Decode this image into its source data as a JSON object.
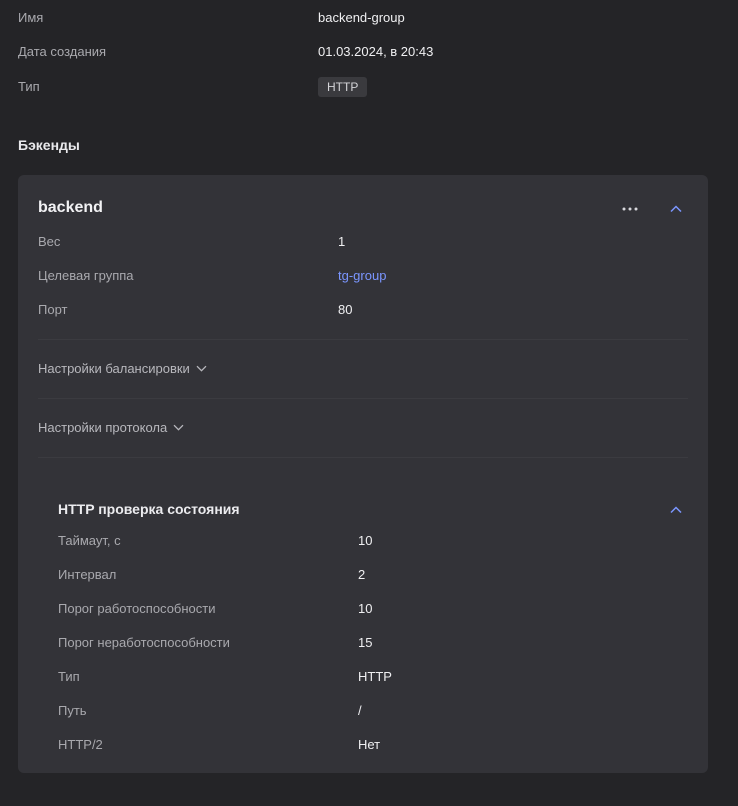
{
  "summary": {
    "name_label": "Имя",
    "name_value": "backend-group",
    "created_label": "Дата создания",
    "created_value": "01.03.2024, в 20:43",
    "type_label": "Тип",
    "type_value": "HTTP"
  },
  "backends_section": {
    "title": "Бэкенды"
  },
  "backend": {
    "title": "backend",
    "weight_label": "Вес",
    "weight_value": "1",
    "target_group_label": "Целевая группа",
    "target_group_value": "tg-group",
    "port_label": "Порт",
    "port_value": "80",
    "balancing_settings_label": "Настройки балансировки",
    "protocol_settings_label": "Настройки протокола"
  },
  "healthcheck": {
    "title": "HTTP проверка состояния",
    "rows": [
      {
        "label": "Таймаут, с",
        "value": "10"
      },
      {
        "label": "Интервал",
        "value": "2"
      },
      {
        "label": "Порог работоспособности",
        "value": "10"
      },
      {
        "label": "Порог неработоспособности",
        "value": "15"
      },
      {
        "label": "Тип",
        "value": "HTTP"
      },
      {
        "label": "Путь",
        "value": "/"
      },
      {
        "label": "HTTP/2",
        "value": "Нет"
      }
    ]
  },
  "icons": {
    "more": "more-horizontal-icon",
    "collapse": "chevron-up-icon",
    "expand": "chevron-down-icon"
  },
  "colors": {
    "background": "#242427",
    "card": "#333338",
    "link": "#7b96ff",
    "accent_chevron": "#7b96ff"
  }
}
